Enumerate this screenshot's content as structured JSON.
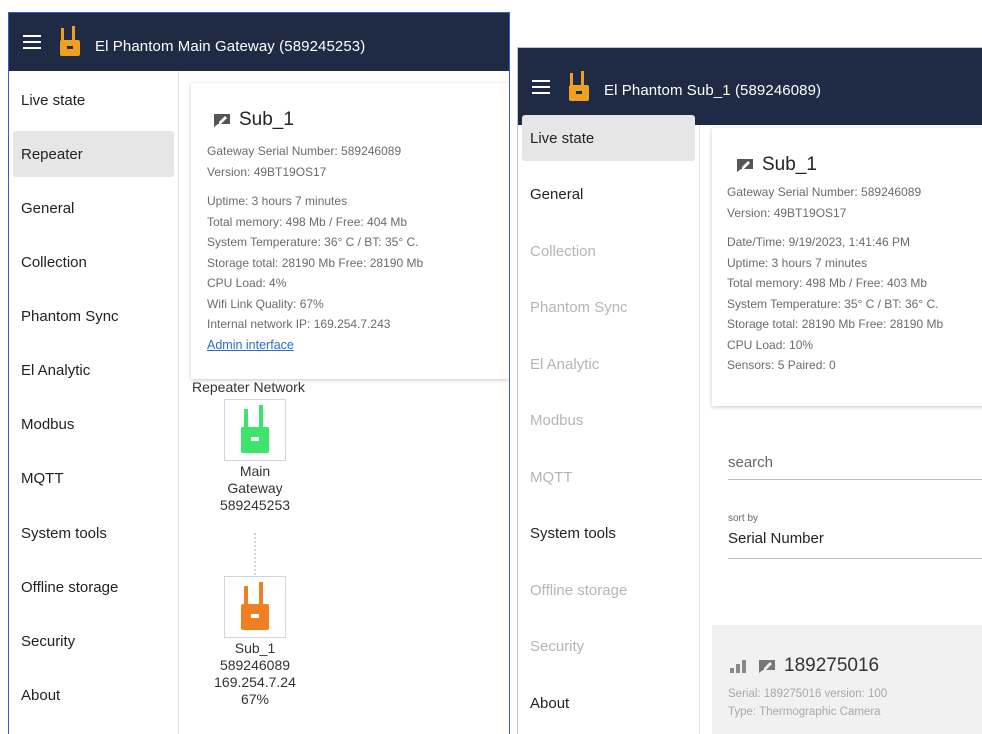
{
  "left_window": {
    "title": "El Phantom Main Gateway (589245253)",
    "nav": [
      {
        "label": "Live state"
      },
      {
        "label": "Repeater"
      },
      {
        "label": "General"
      },
      {
        "label": "Collection"
      },
      {
        "label": "Phantom Sync"
      },
      {
        "label": "El Analytic"
      },
      {
        "label": "Modbus"
      },
      {
        "label": "MQTT"
      },
      {
        "label": "System tools"
      },
      {
        "label": "Offline storage"
      },
      {
        "label": "Security"
      },
      {
        "label": "About"
      }
    ],
    "active_item": "Repeater",
    "card": {
      "title": "Sub_1",
      "serial": "Gateway Serial Number: 589246089",
      "version": "Version: 49BT19OS17",
      "uptime": "Uptime: 3 hours 7 minutes",
      "memory": "Total memory: 498 Mb / Free: 404 Mb",
      "temperature": "System Temperature: 36° C / BT: 35° C.",
      "storage": "Storage total: 28190 Mb Free: 28190 Mb",
      "cpu": "CPU Load: 4%",
      "wifi": "Wifi Link Quality: 67%",
      "ip": "Internal network IP: 169.254.7.243",
      "admin_link": "Admin interface"
    },
    "network": {
      "title": "Repeater Network",
      "main_node": {
        "line1": "Main",
        "line2": "Gateway",
        "line3": "589245253",
        "color": "#3ee36b"
      },
      "sub_node": {
        "line1": "Sub_1",
        "line2": "589246089",
        "line3": "169.254.7.24",
        "line4": "67%",
        "color": "#f07f22"
      }
    }
  },
  "right_window": {
    "title": "El Phantom Sub_1 (589246089)",
    "nav": [
      {
        "label": "Live state"
      },
      {
        "label": "General"
      },
      {
        "label": "Collection"
      },
      {
        "label": "Phantom Sync"
      },
      {
        "label": "El Analytic"
      },
      {
        "label": "Modbus"
      },
      {
        "label": "MQTT"
      },
      {
        "label": "System tools"
      },
      {
        "label": "Offline storage"
      },
      {
        "label": "Security"
      },
      {
        "label": "About"
      }
    ],
    "active_item": "Live state",
    "card": {
      "title": "Sub_1",
      "serial": "Gateway Serial Number: 589246089",
      "version": "Version: 49BT19OS17",
      "datetime": "Date/Time: 9/19/2023, 1:41:46 PM",
      "uptime": "Uptime: 3 hours 7 minutes",
      "memory": "Total memory: 498 Mb / Free: 403 Mb",
      "temperature": "System Temperature: 35° C / BT: 36° C.",
      "storage": "Storage total: 28190 Mb Free: 28190 Mb",
      "cpu": "CPU Load: 10%",
      "sensors": "Sensors: 5 Paired: 0"
    },
    "search_placeholder": "search",
    "sort": {
      "label": "sort by",
      "value": "Serial Number"
    },
    "sensor": {
      "title": "189275016",
      "line1": "Serial: 189275016 version: 100",
      "line2": "Type: Thermographic Camera"
    }
  },
  "colors": {
    "appbar": "#1f2a44",
    "logo": "#f0a020",
    "link": "#2a6dcb",
    "active_nav": "#e6e6e6"
  }
}
